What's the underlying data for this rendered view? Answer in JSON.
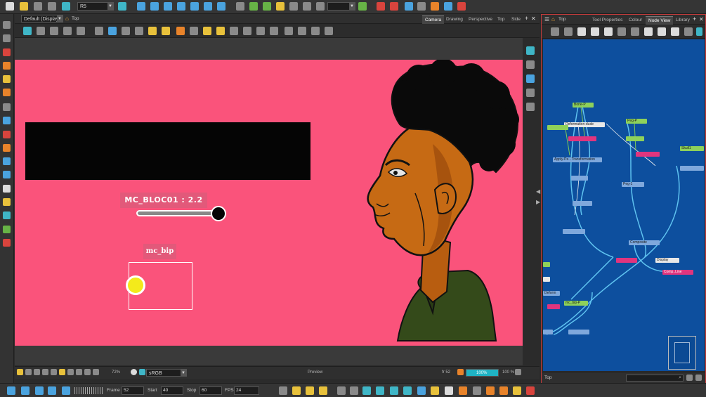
{
  "toolbar": {
    "frame_combo": "R5",
    "workspace_combo": "Default (Display)",
    "breadcrumb_top": "Top"
  },
  "camera_view": {
    "tabs": [
      {
        "label": "Camera"
      },
      {
        "label": "Drawing"
      },
      {
        "label": "Perspective"
      },
      {
        "label": "Top"
      },
      {
        "label": "Side"
      }
    ],
    "slider_label": "MC_BLOC01 : 2.2",
    "slider_value": 2.2,
    "bip_label": "mc_bip"
  },
  "status_bar": {
    "zoom_combo": "72%",
    "color_space": "sRGB",
    "preview_label": "Preview",
    "frame_readout": "fr 52",
    "progress_label": "100%",
    "zoom_level": "100 %"
  },
  "playback": {
    "frame_label": "Frame",
    "frame_value": "52",
    "start_label": "Start",
    "start_value": "40",
    "stop_label": "Stop",
    "stop_value": "60",
    "fps_label": "FPS",
    "fps_value": "24"
  },
  "right_panel": {
    "breadcrumb": "Top",
    "tabs": [
      {
        "label": "Tool Properties"
      },
      {
        "label": "Colour"
      },
      {
        "label": "Node View"
      },
      {
        "label": "Library"
      }
    ],
    "footer_label": "Top"
  },
  "node_view": {
    "nodes": [
      {
        "label": "Bone-P"
      },
      {
        "label": "Deformation-dude"
      },
      {
        "label": "Apply-Pe...Transformation"
      },
      {
        "label": "Peg-P"
      },
      {
        "label": "Skull1"
      },
      {
        "label": "Peg-1"
      },
      {
        "label": "Composite"
      },
      {
        "label": "Display"
      },
      {
        "label": "Comp..Line"
      },
      {
        "label": "Deform"
      },
      {
        "label": "mc_bip-P"
      }
    ]
  },
  "colors": {
    "stage_bg": "#fa537b",
    "label_bg": "#e2597a",
    "node_view_bg": "#0d4f9e",
    "accent_teal": "#3fb6c7",
    "handle_yellow": "#f3ea1b"
  }
}
